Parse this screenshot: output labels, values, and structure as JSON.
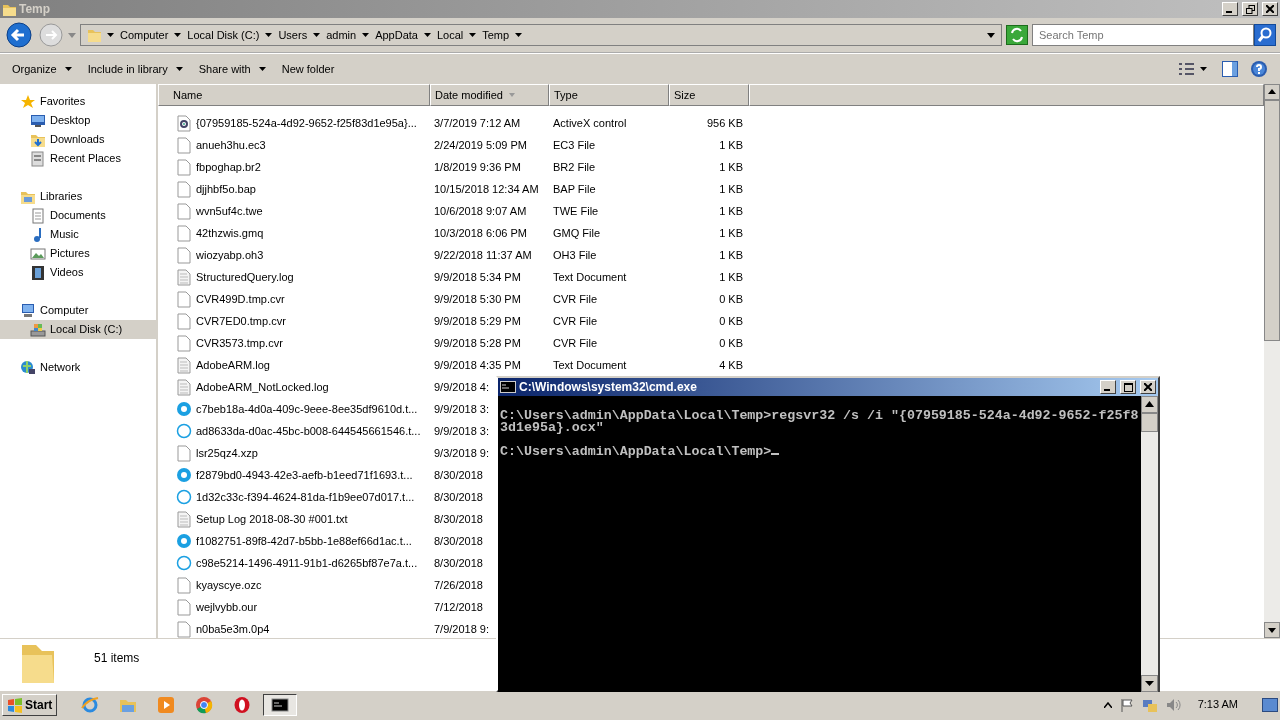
{
  "window": {
    "title": "Temp"
  },
  "breadcrumb": [
    "Computer",
    "Local Disk (C:)",
    "Users",
    "admin",
    "AppData",
    "Local",
    "Temp"
  ],
  "search": {
    "placeholder": "Search Temp"
  },
  "toolbar": [
    {
      "label": "Organize",
      "dropdown": true
    },
    {
      "label": "Include in library",
      "dropdown": true
    },
    {
      "label": "Share with",
      "dropdown": true
    },
    {
      "label": "New folder",
      "dropdown": false
    }
  ],
  "nav": [
    {
      "label": "Favorites",
      "kind": "star",
      "selected": false,
      "children": [
        {
          "label": "Desktop",
          "kind": "desktop",
          "selected": false
        },
        {
          "label": "Downloads",
          "kind": "downloads",
          "selected": false
        },
        {
          "label": "Recent Places",
          "kind": "recent",
          "selected": false
        }
      ]
    },
    {
      "label": "Libraries",
      "kind": "libraries",
      "selected": false,
      "children": [
        {
          "label": "Documents",
          "kind": "documents",
          "selected": false
        },
        {
          "label": "Music",
          "kind": "music",
          "selected": false
        },
        {
          "label": "Pictures",
          "kind": "pictures",
          "selected": false
        },
        {
          "label": "Videos",
          "kind": "videos",
          "selected": false
        }
      ]
    },
    {
      "label": "Computer",
      "kind": "computer",
      "selected": false,
      "children": [
        {
          "label": "Local Disk (C:)",
          "kind": "drive",
          "selected": true
        }
      ]
    },
    {
      "label": "Network",
      "kind": "network",
      "selected": false
    }
  ],
  "columns": [
    {
      "label": "Name",
      "sorted": false
    },
    {
      "label": "Date modified",
      "sorted": true
    },
    {
      "label": "Type",
      "sorted": false
    },
    {
      "label": "Size",
      "sorted": false
    }
  ],
  "files": [
    {
      "name": "{07959185-524a-4d92-9652-f25f83d1e95a}...",
      "kind": "activex",
      "date": "3/7/2019 7:12 AM",
      "type": "ActiveX control",
      "size": "956 KB"
    },
    {
      "name": "anueh3hu.ec3",
      "kind": "file",
      "date": "2/24/2019 5:09 PM",
      "type": "EC3 File",
      "size": "1 KB"
    },
    {
      "name": "fbpoghap.br2",
      "kind": "file",
      "date": "1/8/2019 9:36 PM",
      "type": "BR2 File",
      "size": "1 KB"
    },
    {
      "name": "djjhbf5o.bap",
      "kind": "file",
      "date": "10/15/2018 12:34 AM",
      "type": "BAP File",
      "size": "1 KB"
    },
    {
      "name": "wvn5uf4c.twe",
      "kind": "file",
      "date": "10/6/2018 9:07 AM",
      "type": "TWE File",
      "size": "1 KB"
    },
    {
      "name": "42thzwis.gmq",
      "kind": "file",
      "date": "10/3/2018 6:06 PM",
      "type": "GMQ File",
      "size": "1 KB"
    },
    {
      "name": "wiozyabp.oh3",
      "kind": "file",
      "date": "9/22/2018 11:37 AM",
      "type": "OH3 File",
      "size": "1 KB"
    },
    {
      "name": "StructuredQuery.log",
      "kind": "text",
      "date": "9/9/2018 5:34 PM",
      "type": "Text Document",
      "size": "1 KB"
    },
    {
      "name": "CVR499D.tmp.cvr",
      "kind": "file",
      "date": "9/9/2018 5:30 PM",
      "type": "CVR File",
      "size": "0 KB"
    },
    {
      "name": "CVR7ED0.tmp.cvr",
      "kind": "file",
      "date": "9/9/2018 5:29 PM",
      "type": "CVR File",
      "size": "0 KB"
    },
    {
      "name": "CVR3573.tmp.cvr",
      "kind": "file",
      "date": "9/9/2018 5:28 PM",
      "type": "CVR File",
      "size": "0 KB"
    },
    {
      "name": "AdobeARM.log",
      "kind": "text",
      "date": "9/9/2018 4:35 PM",
      "type": "Text Document",
      "size": "4 KB"
    },
    {
      "name": "AdobeARM_NotLocked.log",
      "kind": "text",
      "date": "9/9/2018 4:"
    },
    {
      "name": "c7beb18a-4d0a-409c-9eee-8ee35df9610d.t...",
      "kind": "skype",
      "date": "9/9/2018 3:"
    },
    {
      "name": "ad8633da-d0ac-45bc-b008-644545661546.t...",
      "kind": "skype-outline",
      "date": "9/9/2018 3:"
    },
    {
      "name": "lsr25qz4.xzp",
      "kind": "file",
      "date": "9/3/2018 9:"
    },
    {
      "name": "f2879bd0-4943-42e3-aefb-b1eed71f1693.t...",
      "kind": "skype",
      "date": "8/30/2018"
    },
    {
      "name": "1d32c33c-f394-4624-81da-f1b9ee07d017.t...",
      "kind": "skype-outline",
      "date": "8/30/2018"
    },
    {
      "name": "Setup Log 2018-08-30 #001.txt",
      "kind": "text",
      "date": "8/30/2018"
    },
    {
      "name": "f1082751-89f8-42d7-b5bb-1e88ef66d1ac.t...",
      "kind": "skype",
      "date": "8/30/2018"
    },
    {
      "name": "c98e5214-1496-4911-91b1-d6265bf87e7a.t...",
      "kind": "skype-outline",
      "date": "8/30/2018"
    },
    {
      "name": "kyayscye.ozc",
      "kind": "file",
      "date": "7/26/2018"
    },
    {
      "name": "wejlvybb.our",
      "kind": "file",
      "date": "7/12/2018"
    },
    {
      "name": "n0ba5e3m.0p4",
      "kind": "file",
      "date": "7/9/2018 9:"
    }
  ],
  "status": {
    "count": "51 items"
  },
  "console": {
    "title": "C:\\Windows\\system32\\cmd.exe",
    "blocks": [
      [
        "C:\\Users\\admin\\AppData\\Local\\Temp>regsvr32 /s /i \"{07959185-524a-4d92-9652-f25f8",
        "3d1e95a}.ocx\""
      ],
      [
        "C:\\Users\\admin\\AppData\\Local\\Temp>"
      ]
    ],
    "cursor": true
  },
  "taskbar": {
    "start": "Start",
    "apps": [
      {
        "kind": "ie",
        "selected": false
      },
      {
        "kind": "explorer",
        "selected": false
      },
      {
        "kind": "media",
        "selected": false
      },
      {
        "kind": "chrome",
        "selected": false
      },
      {
        "kind": "opera",
        "selected": false
      },
      {
        "kind": "cmd",
        "selected": true
      }
    ],
    "time": "7:13 AM"
  }
}
